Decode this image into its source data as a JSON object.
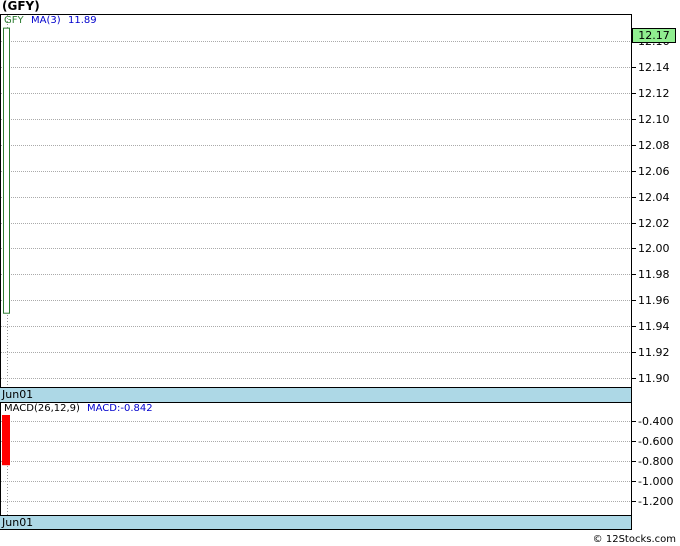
{
  "ticker_title": "(GFY)",
  "legend": {
    "symbol": "GFY",
    "ma_label": "MA(3)",
    "ma_value": "11.89",
    "macd_label": "MACD(26,12,9)",
    "macd_value_label": "MACD:-0.842"
  },
  "last_price_label": "12.17",
  "date_label_top": "Jun01",
  "date_label_bottom": "Jun01",
  "copyright": "© 12Stocks.com",
  "colors": {
    "price_candle": "#2e7d32",
    "macd_bar": "#ff0000",
    "band": "#add8e6",
    "last_price_bg": "#90ee90",
    "ma_text": "#0000cc"
  },
  "chart_data": [
    {
      "type": "bar",
      "name": "price",
      "ylim": [
        11.88,
        12.18
      ],
      "yticks": [
        "11.90",
        "11.92",
        "11.94",
        "11.96",
        "11.98",
        "12.00",
        "12.02",
        "12.04",
        "12.06",
        "12.08",
        "12.10",
        "12.12",
        "12.14",
        "12.16"
      ],
      "categories": [
        "Jun01"
      ],
      "candle": {
        "high": 12.17,
        "low": 11.95
      },
      "grid": true
    },
    {
      "type": "bar",
      "name": "macd",
      "ylim": [
        -1.3,
        -0.3
      ],
      "yticks": [
        "-0.400",
        "-0.600",
        "-0.800",
        "-1.000",
        "-1.200"
      ],
      "categories": [
        "Jun01"
      ],
      "bar": {
        "top": -0.3,
        "bottom": -0.842
      },
      "grid": true
    }
  ]
}
